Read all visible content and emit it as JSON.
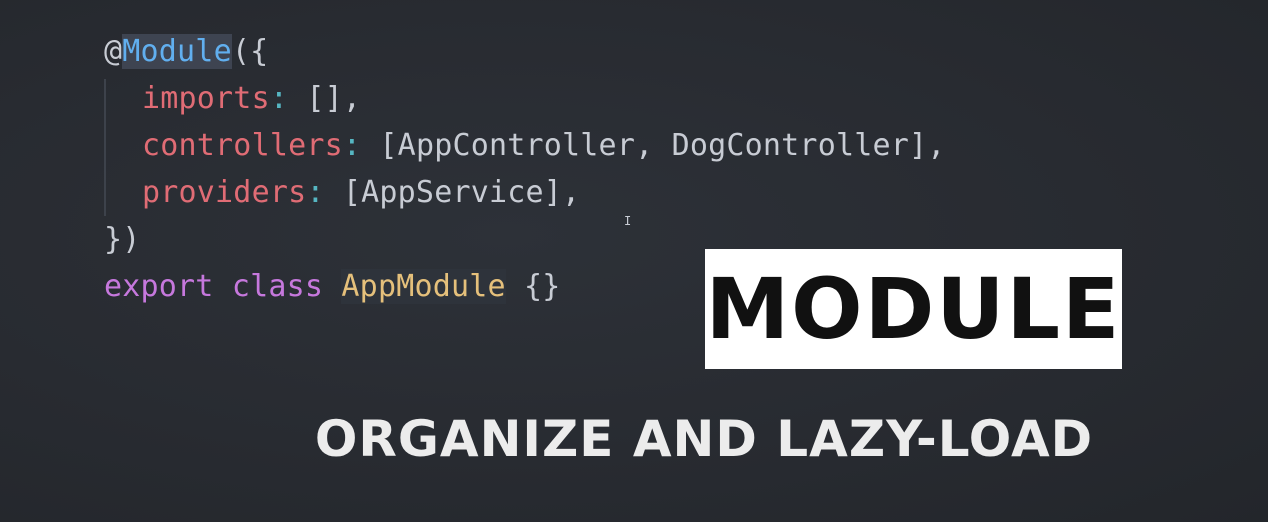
{
  "code": {
    "at": "@",
    "decorator": "Module",
    "open": "({",
    "imports_key": "imports",
    "imports_colon": ":",
    "imports_val": " [],",
    "controllers_key": "controllers",
    "controllers_colon": ":",
    "controllers_val": " [AppController, DogController],",
    "providers_key": "providers",
    "providers_colon": ":",
    "providers_val": " [AppService],",
    "close": "})",
    "export_kw": "export",
    "class_kw": "class",
    "class_name": "AppModule",
    "class_body": "{}"
  },
  "cursor": "I",
  "badge": {
    "label": "MODULE"
  },
  "subtitle": "ORGANIZE AND LAZY-LOAD",
  "colors": {
    "background": "#282b31",
    "keyword": "#c678dd",
    "decorator": "#61afef",
    "property": "#e06c75",
    "punctuation": "#56b6c2",
    "class_name": "#e5c07b",
    "text": "#c8ccd4",
    "badge_bg": "#ffffff",
    "badge_text": "#111111"
  }
}
